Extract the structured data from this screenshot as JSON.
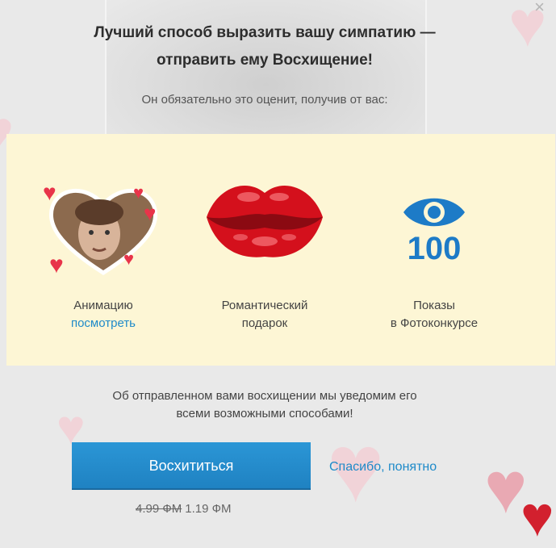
{
  "dialog": {
    "title_line1": "Лучший способ выразить вашу симпатию —",
    "title_line2": "отправить ему Восхищение!",
    "subtitle": "Он обязательно это оценит, получив от вас:",
    "close_glyph": "×"
  },
  "features": [
    {
      "label": "Анимацию",
      "link": "посмотреть"
    },
    {
      "label_line1": "Романтический",
      "label_line2": "подарок"
    },
    {
      "number": "100",
      "label_line1": "Показы",
      "label_line2": "в Фотоконкурсе"
    }
  ],
  "note": {
    "line1": "Об отправленном вами восхищении мы уведомим его",
    "line2": "всеми возможными способами!"
  },
  "actions": {
    "primary_label": "Восхититься",
    "secondary_label": "Спасибо, понятно"
  },
  "price": {
    "old": "4.99 ФМ",
    "new": "1.19 ФМ"
  },
  "colors": {
    "accent": "#1f82c2",
    "link": "#1e8ac9",
    "panel": "#fdf6d5",
    "heart": "#d2202e"
  }
}
